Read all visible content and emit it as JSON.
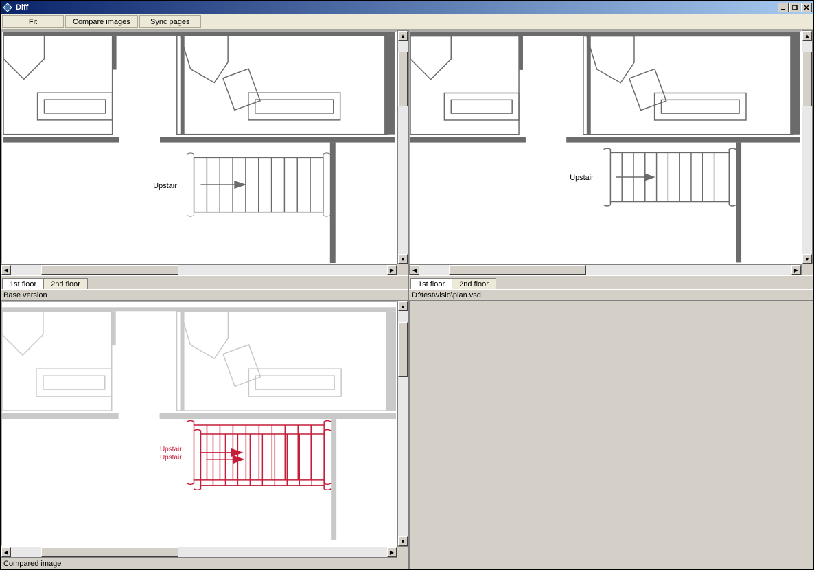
{
  "window": {
    "title": "Diff"
  },
  "toolbar": {
    "fit": "Fit",
    "compare": "Compare images",
    "sync": "Sync pages"
  },
  "panes": {
    "topLeft": {
      "tabs": [
        "1st floor",
        "2nd floor"
      ],
      "activeTab": 0,
      "status": "Base version",
      "stairLabel": "Upstair"
    },
    "topRight": {
      "tabs": [
        "1st floor",
        "2nd floor"
      ],
      "activeTab": 0,
      "status": "D:\\test\\visio\\plan.vsd",
      "stairLabel": "Upstair"
    },
    "bottomLeft": {
      "status": "Compared image",
      "stairLabel1": "Upstair",
      "stairLabel2": "Upstair"
    }
  },
  "colors": {
    "diffHighlight": "#c41e3a",
    "planLine": "#6b6b6b",
    "planLineFaded": "#c9c9c9"
  }
}
